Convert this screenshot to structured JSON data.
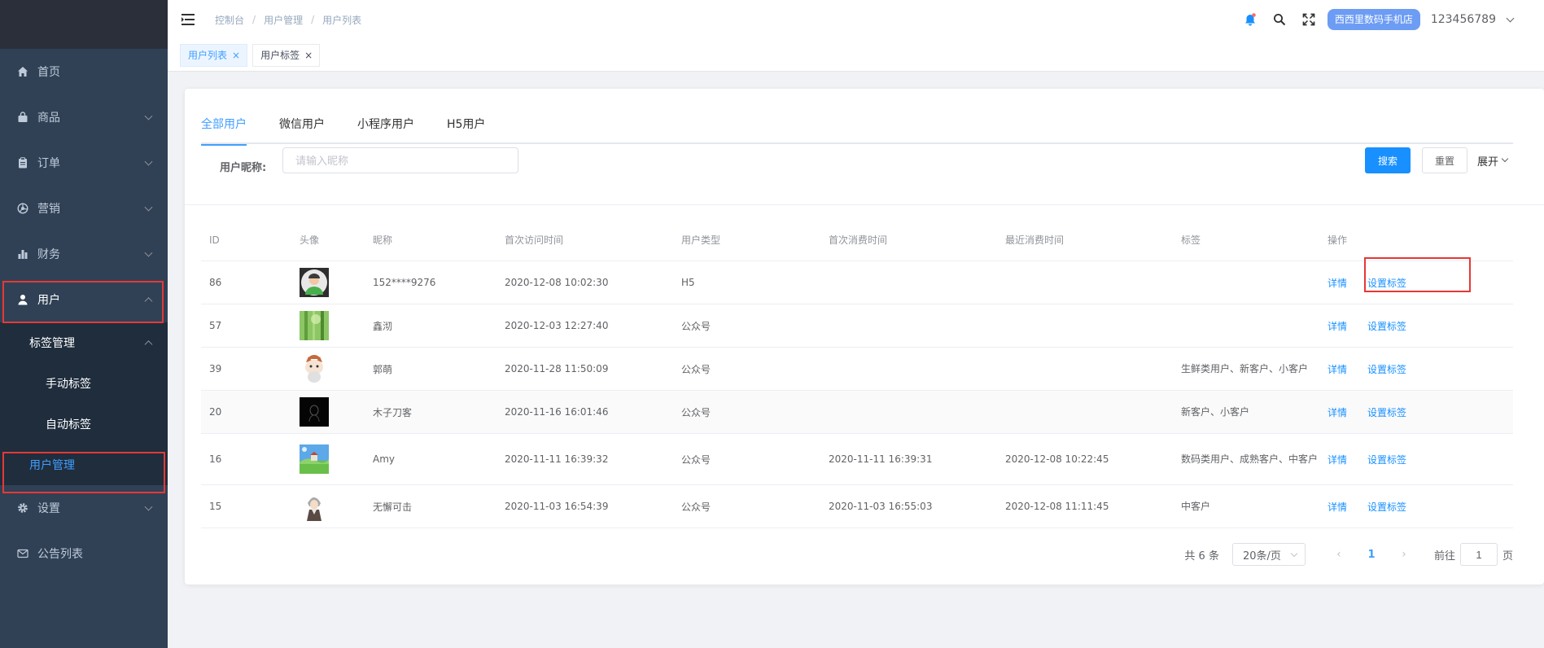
{
  "sidebar": {
    "items": [
      {
        "label": "首页",
        "icon": "home-icon"
      },
      {
        "label": "商品",
        "icon": "bag-icon"
      },
      {
        "label": "订单",
        "icon": "clipboard-icon"
      },
      {
        "label": "营销",
        "icon": "aperture-icon"
      },
      {
        "label": "财务",
        "icon": "bar-chart-icon"
      },
      {
        "label": "用户",
        "icon": "user-icon"
      },
      {
        "label": "设置",
        "icon": "gear-icon"
      },
      {
        "label": "公告列表",
        "icon": "mail-icon"
      }
    ],
    "sub": {
      "group_label": "标签管理",
      "manual": "手动标签",
      "auto": "自动标签",
      "user_mgmt": "用户管理"
    }
  },
  "header": {
    "breadcrumb": [
      "控制台",
      "用户管理",
      "用户列表"
    ],
    "breadcrumb_sep": "/",
    "store": "西西里数码手机店",
    "username": "123456789"
  },
  "tags_view": {
    "tags": [
      {
        "label": "用户列表",
        "active": true
      },
      {
        "label": "用户标签",
        "active": false
      }
    ],
    "close": "×"
  },
  "tabs": [
    "全部用户",
    "微信用户",
    "小程序用户",
    "H5用户"
  ],
  "filter": {
    "label": "用户昵称:",
    "placeholder": "请输入昵称",
    "search": "搜索",
    "reset": "重置",
    "expand": "展开"
  },
  "table": {
    "columns": [
      "ID",
      "头像",
      "昵称",
      "首次访问时间",
      "用户类型",
      "首次消费时间",
      "最近消费时间",
      "标签",
      "操作"
    ],
    "detail": "详情",
    "set_tag": "设置标签",
    "rows": [
      {
        "id": "86",
        "avatar": "avatar-person-icon",
        "nick": "152****9276",
        "first_visit": "2020-12-08 10:02:30",
        "type": "H5",
        "first_pay": "",
        "last_pay": "",
        "tags": ""
      },
      {
        "id": "57",
        "avatar": "avatar-bamboo-icon",
        "nick": "鑫沏",
        "first_visit": "2020-12-03 12:27:40",
        "type": "公众号",
        "first_pay": "",
        "last_pay": "",
        "tags": ""
      },
      {
        "id": "39",
        "avatar": "avatar-cat-icon",
        "nick": "郭萌",
        "first_visit": "2020-11-28 11:50:09",
        "type": "公众号",
        "first_pay": "",
        "last_pay": "",
        "tags": "生鲜类用户、新客户、小客户"
      },
      {
        "id": "20",
        "avatar": "avatar-dark-icon",
        "nick": "木子刀客",
        "first_visit": "2020-11-16 16:01:46",
        "type": "公众号",
        "first_pay": "",
        "last_pay": "",
        "tags": "新客户、小客户"
      },
      {
        "id": "16",
        "avatar": "avatar-landscape-icon",
        "nick": "Amy",
        "first_visit": "2020-11-11 16:39:32",
        "type": "公众号",
        "first_pay": "2020-11-11 16:39:31",
        "last_pay": "2020-12-08 10:22:45",
        "tags": "数码类用户、成熟客户、中客户"
      },
      {
        "id": "15",
        "avatar": "avatar-anime-icon",
        "nick": "无懈可击",
        "first_visit": "2020-11-03 16:54:39",
        "type": "公众号",
        "first_pay": "2020-11-03 16:55:03",
        "last_pay": "2020-12-08 11:11:45",
        "tags": "中客户"
      }
    ]
  },
  "pagination": {
    "total": "共 6 条",
    "page_size": "20条/页",
    "current": "1",
    "goto_prefix": "前往",
    "goto_value": "1",
    "goto_suffix": "页"
  },
  "colors": {
    "sidebar_bg": "#304156",
    "accent": "#1890ff",
    "highlight_box": "#e53935"
  }
}
